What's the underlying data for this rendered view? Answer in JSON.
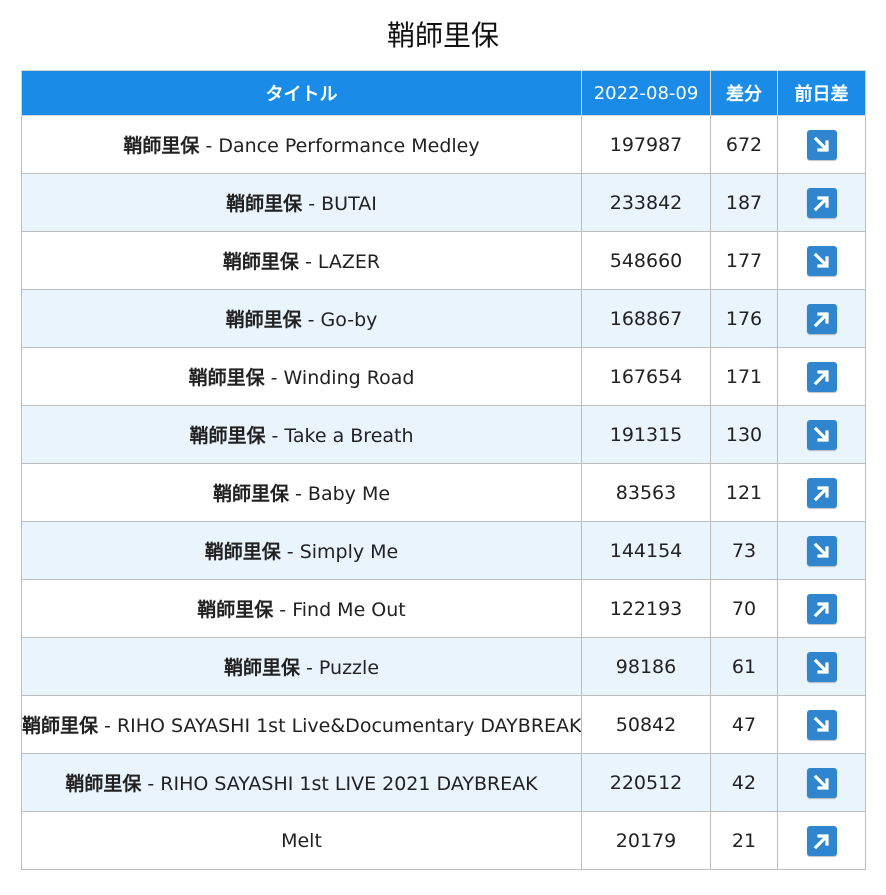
{
  "page": {
    "title": "鞘師里保"
  },
  "table": {
    "headers": {
      "title": "タイトル",
      "date": "2022-08-09",
      "diff": "差分",
      "prev_diff": "前日差"
    },
    "rows": [
      {
        "artist": "鞘師里保",
        "sep": " - ",
        "song": "Dance Performance Medley",
        "count": "197987",
        "diff": "672",
        "trend": "down",
        "trend_icon": "arrow-down-right-icon"
      },
      {
        "artist": "鞘師里保",
        "sep": " - ",
        "song": "BUTAI",
        "count": "233842",
        "diff": "187",
        "trend": "up",
        "trend_icon": "arrow-up-right-icon"
      },
      {
        "artist": "鞘師里保",
        "sep": " - ",
        "song": "LAZER",
        "count": "548660",
        "diff": "177",
        "trend": "down",
        "trend_icon": "arrow-down-right-icon"
      },
      {
        "artist": "鞘師里保",
        "sep": " - ",
        "song": "Go-by",
        "count": "168867",
        "diff": "176",
        "trend": "up",
        "trend_icon": "arrow-up-right-icon"
      },
      {
        "artist": "鞘師里保",
        "sep": " - ",
        "song": "Winding Road",
        "count": "167654",
        "diff": "171",
        "trend": "up",
        "trend_icon": "arrow-up-right-icon"
      },
      {
        "artist": "鞘師里保",
        "sep": " - ",
        "song": "Take a Breath",
        "count": "191315",
        "diff": "130",
        "trend": "down",
        "trend_icon": "arrow-down-right-icon"
      },
      {
        "artist": "鞘師里保",
        "sep": " - ",
        "song": "Baby Me",
        "count": "83563",
        "diff": "121",
        "trend": "up",
        "trend_icon": "arrow-up-right-icon"
      },
      {
        "artist": "鞘師里保",
        "sep": " - ",
        "song": "Simply Me",
        "count": "144154",
        "diff": "73",
        "trend": "down",
        "trend_icon": "arrow-down-right-icon"
      },
      {
        "artist": "鞘師里保",
        "sep": " - ",
        "song": "Find Me Out",
        "count": "122193",
        "diff": "70",
        "trend": "up",
        "trend_icon": "arrow-up-right-icon"
      },
      {
        "artist": "鞘師里保",
        "sep": " - ",
        "song": "Puzzle",
        "count": "98186",
        "diff": "61",
        "trend": "down",
        "trend_icon": "arrow-down-right-icon"
      },
      {
        "artist": "鞘師里保",
        "sep": " - ",
        "song": "RIHO SAYASHI 1st Live&Documentary DAYBREAK",
        "count": "50842",
        "diff": "47",
        "trend": "down",
        "trend_icon": "arrow-down-right-icon"
      },
      {
        "artist": "鞘師里保",
        "sep": " - ",
        "song": "RIHO SAYASHI 1st LIVE 2021 DAYBREAK",
        "count": "220512",
        "diff": "42",
        "trend": "down",
        "trend_icon": "arrow-down-right-icon"
      },
      {
        "artist": "",
        "sep": "",
        "song": "Melt",
        "count": "20179",
        "diff": "21",
        "trend": "up",
        "trend_icon": "arrow-up-right-icon"
      }
    ]
  },
  "colors": {
    "header_bg": "#1a8ce8",
    "row_alt_bg": "#eaf4fd",
    "trend_icon_bg": "#2f86cf"
  }
}
